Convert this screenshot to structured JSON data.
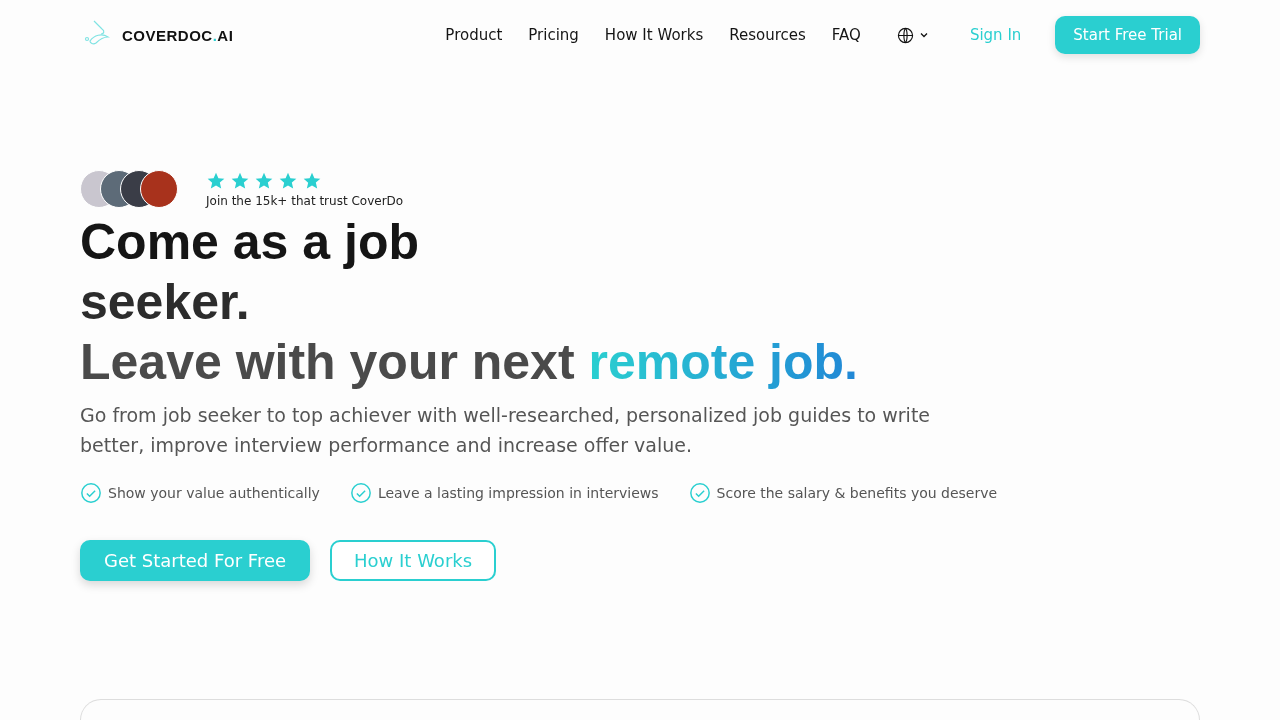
{
  "logo": {
    "parts": [
      {
        "text": "COVERDOC",
        "accent": false
      },
      {
        "text": ".",
        "accent": true
      },
      {
        "text": "AI",
        "accent": false
      }
    ]
  },
  "nav": {
    "links": [
      "Product",
      "Pricing",
      "How It Works",
      "Resources",
      "FAQ"
    ],
    "sign_in": "Sign In",
    "cta": "Start Free Trial"
  },
  "trust": {
    "avatars": [
      {
        "color": "#c9c6cf"
      },
      {
        "color": "#5d6b78"
      },
      {
        "color": "#3a3d47"
      },
      {
        "color": "#a8321c"
      }
    ],
    "stars": 5,
    "text": "Join the 15k+ that trust CoverDo"
  },
  "hero": {
    "lines": [
      {
        "text": "Come as a job"
      },
      {
        "text": "seeker."
      },
      {
        "text": "Leave with your next",
        "highlight": "remote job."
      }
    ],
    "subtitle": "Go from job seeker to top achiever with well-researched, personalized job guides to write better, improve interview performance and increase offer value.",
    "benefits": [
      "Show your value authentically",
      "Leave a lasting impression in interviews",
      "Score the salary & benefits you deserve"
    ],
    "primary": "Get Started For Free",
    "secondary": "How It Works"
  }
}
